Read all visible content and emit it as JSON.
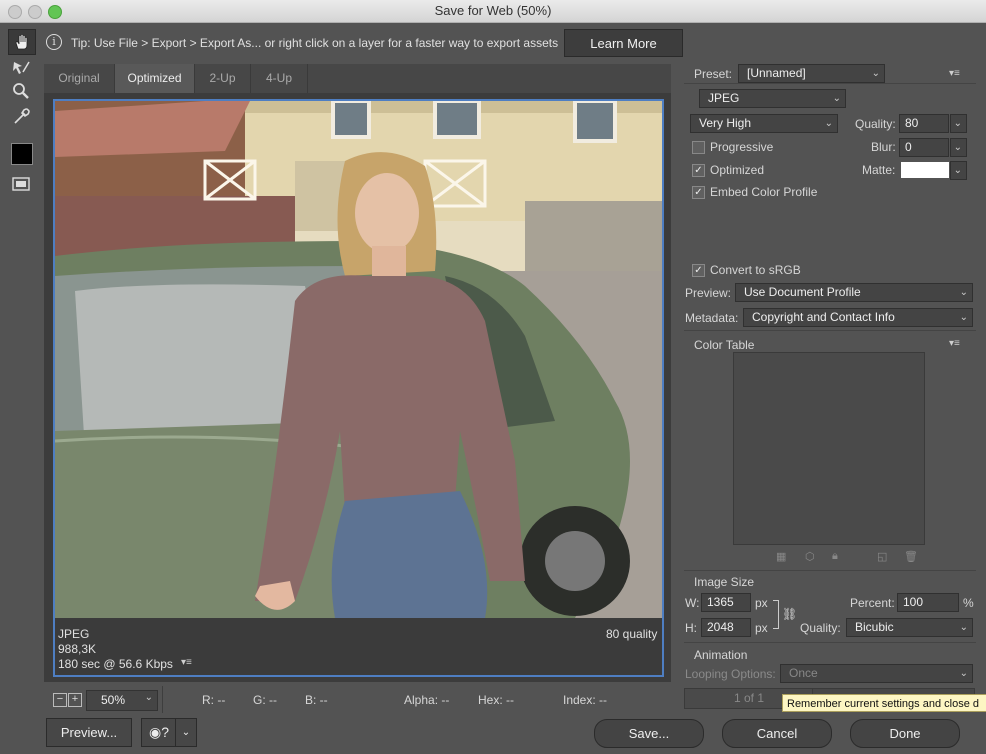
{
  "window": {
    "title": "Save for Web (50%)"
  },
  "tip": {
    "text": "Tip: Use File > Export > Export As...  or right click on a layer for a faster way to export assets",
    "button": "Learn More"
  },
  "tools": [
    "hand-icon",
    "slice-select-icon",
    "zoom-icon",
    "eyedropper-icon",
    "color-swatch",
    "toggle-slices-icon"
  ],
  "tabs": [
    "Original",
    "Optimized",
    "2-Up",
    "4-Up"
  ],
  "preview_info": {
    "format": "JPEG",
    "size": "988,3K",
    "time": "180 sec @ 56.6 Kbps",
    "quality": "80 quality"
  },
  "status": {
    "zoom": "50%",
    "r": "R: --",
    "g": "G: --",
    "b": "B: --",
    "alpha": "Alpha: --",
    "hex": "Hex: --",
    "index": "Index: --"
  },
  "buttons": {
    "preview": "Preview...",
    "save": "Save...",
    "cancel": "Cancel",
    "done": "Done"
  },
  "settings": {
    "preset_label": "Preset:",
    "preset": "[Unnamed]",
    "format": "JPEG",
    "quality_preset": "Very High",
    "quality_label": "Quality:",
    "quality": "80",
    "progressive": "Progressive",
    "blur_label": "Blur:",
    "blur": "0",
    "optimized": "Optimized",
    "matte_label": "Matte:",
    "embed_profile": "Embed Color Profile",
    "convert_srgb": "Convert to sRGB",
    "preview_label": "Preview:",
    "preview_value": "Use Document Profile",
    "metadata_label": "Metadata:",
    "metadata_value": "Copyright and Contact Info",
    "color_table": "Color Table"
  },
  "image_size": {
    "heading": "Image Size",
    "w_label": "W:",
    "w": "1365",
    "h_label": "H:",
    "h": "2048",
    "unit": "px",
    "percent_label": "Percent:",
    "percent": "100",
    "percent_unit": "%",
    "quality_label": "Quality:",
    "quality": "Bicubic"
  },
  "animation": {
    "heading": "Animation",
    "looping_label": "Looping Options:",
    "looping": "Once",
    "frame": "1 of 1"
  },
  "tooltip": "Remember current settings and close d",
  "colors": {
    "accent_border": "#4e7ec2",
    "panel_bg": "#535353"
  }
}
